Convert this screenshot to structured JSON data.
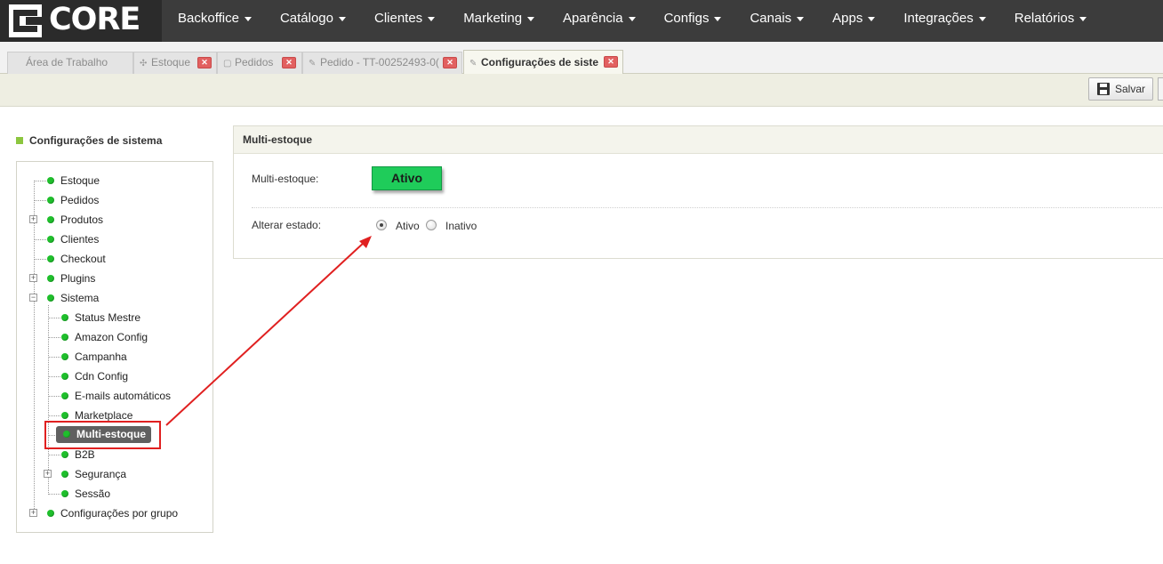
{
  "brand": {
    "logo_text": "CORE"
  },
  "nav": {
    "items": [
      "Backoffice",
      "Catálogo",
      "Clientes",
      "Marketing",
      "Aparência",
      "Configs",
      "Canais",
      "Apps",
      "Integrações",
      "Relatórios"
    ]
  },
  "tabs": [
    {
      "label": "Área de Trabalho",
      "icon": "none"
    },
    {
      "label": "Estoque",
      "icon": "move-icon"
    },
    {
      "label": "Pedidos",
      "icon": "document-icon"
    },
    {
      "label": "Pedido - TT-00252493-0(",
      "icon": "pencil-icon"
    },
    {
      "label": "Configurações de siste",
      "icon": "pencil-icon",
      "active": true
    }
  ],
  "toolbar": {
    "save_label": "Salvar"
  },
  "sidebar": {
    "title": "Configurações de sistema",
    "tree": [
      {
        "label": "Estoque"
      },
      {
        "label": "Pedidos"
      },
      {
        "label": "Produtos",
        "expander": "+"
      },
      {
        "label": "Clientes"
      },
      {
        "label": "Checkout"
      },
      {
        "label": "Plugins",
        "expander": "+"
      },
      {
        "label": "Sistema",
        "expander": "-"
      },
      {
        "label": "Status Mestre"
      },
      {
        "label": "Amazon Config"
      },
      {
        "label": "Campanha"
      },
      {
        "label": "Cdn Config"
      },
      {
        "label": "E-mails automáticos"
      },
      {
        "label": "Marketplace"
      },
      {
        "label": "Multi-estoque",
        "selected": true
      },
      {
        "label": "B2B"
      },
      {
        "label": "Segurança",
        "expander": "+"
      },
      {
        "label": "Sessão"
      },
      {
        "label": "Configurações por grupo",
        "expander": "+"
      }
    ]
  },
  "panel": {
    "title": "Multi-estoque",
    "status_label": "Multi-estoque:",
    "status_value": "Ativo",
    "status_color": "#1fcc5a",
    "change_label": "Alterar estado:",
    "options": [
      {
        "label": "Ativo",
        "checked": true
      },
      {
        "label": "Inativo",
        "checked": false
      }
    ]
  },
  "annotation": {
    "color": "#e02020"
  }
}
